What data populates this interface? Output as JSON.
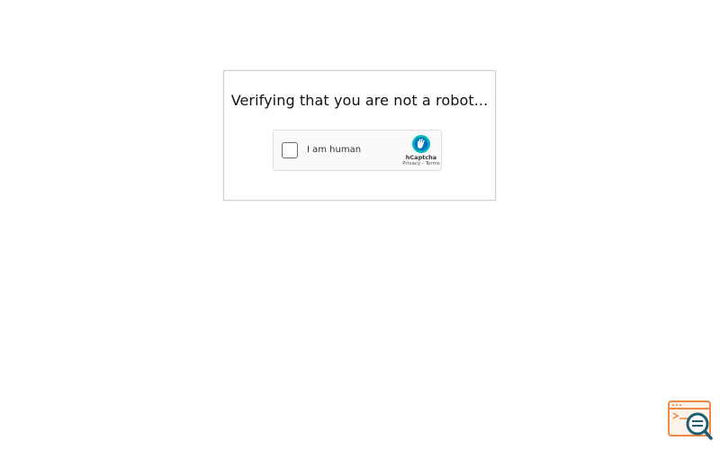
{
  "verification": {
    "title": "Verifying that you are not a robot..."
  },
  "captcha": {
    "checkbox_label": "I am human",
    "brand_name": "hCaptcha",
    "privacy_link": "Privacy",
    "separator": " - ",
    "terms_link": "Terms",
    "checked": false,
    "brand_color": "#0074bf",
    "brand_accent": "#00bbbf"
  },
  "help_widget": {
    "icon": "search-document-icon",
    "accent_color": "#ee8a48",
    "icon_color": "#1d5f6d"
  }
}
